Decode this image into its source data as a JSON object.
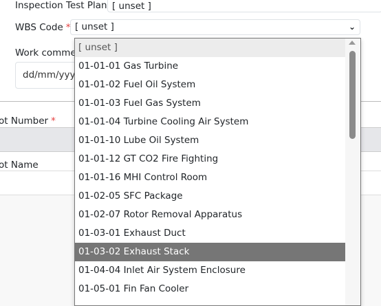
{
  "form": {
    "itp_label": "Inspection Test Plan",
    "itp_value": "[ unset ]",
    "wbs_label": "WBS Code",
    "required_mark": "*",
    "wbs_value": "[ unset ]",
    "work_label": "Work commen",
    "date_placeholder": "dd/mm/yyy",
    "lot_number_label": "ot Number",
    "lot_name_label": "ot Name"
  },
  "dropdown": {
    "options": [
      "[ unset ]",
      "01-01-01 Gas Turbine",
      "01-01-02 Fuel Oil System",
      "01-01-03 Fuel Gas System",
      "01-01-04 Turbine Cooling Air System",
      "01-01-10 Lube Oil System",
      "01-01-12 GT CO2 Fire Fighting",
      "01-01-16 MHI Control Room",
      "01-02-05 SFC Package",
      "01-02-07 Rotor Removal Apparatus",
      "01-03-01 Exhaust Duct",
      "01-03-02 Exhaust Stack",
      "01-04-04 Inlet Air System Enclosure",
      "01-05-01 Fin Fan Cooler"
    ],
    "highlighted": "01-03-02 Exhaust Stack"
  }
}
